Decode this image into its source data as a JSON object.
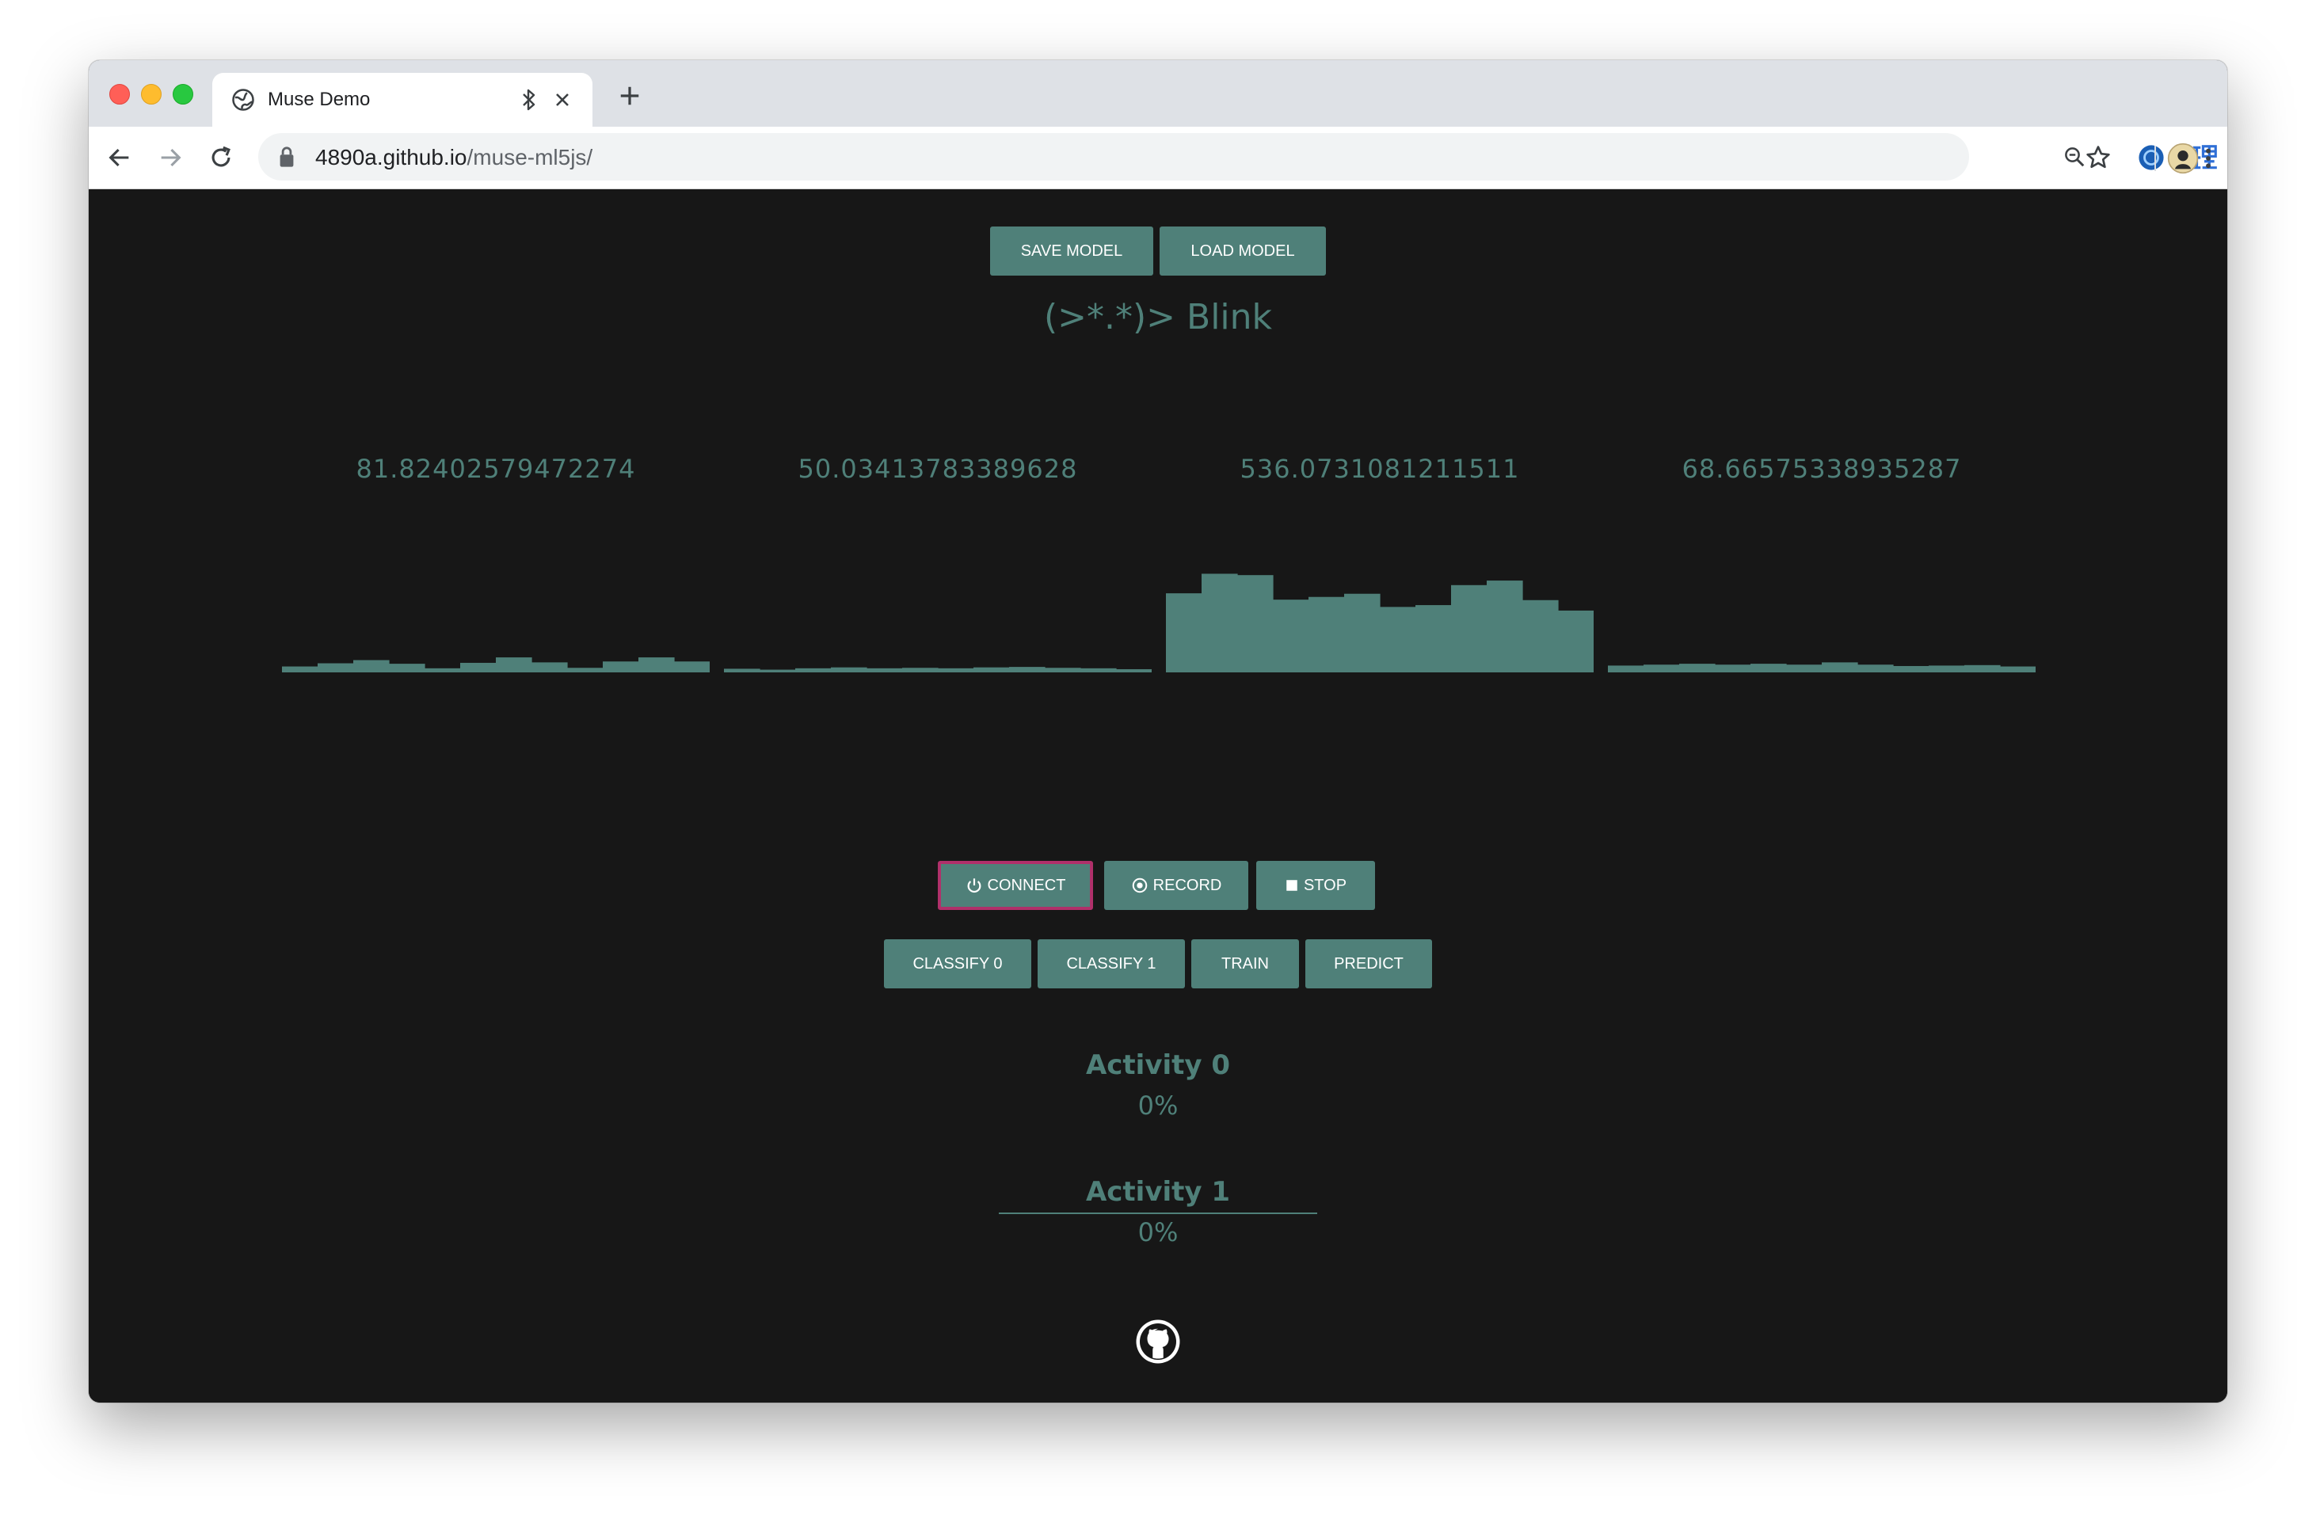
{
  "browser": {
    "tab_title": "Muse Demo",
    "url_host": "4890a.github.io",
    "url_path": "/muse-ml5js/",
    "icons": [
      "globe-icon",
      "bluetooth-icon",
      "close-icon",
      "plus-icon",
      "back-icon",
      "forward-icon",
      "reload-icon",
      "lock-icon",
      "zoom-icon",
      "star-icon",
      "extension-icon",
      "translate-icon",
      "avatar",
      "more-icon"
    ]
  },
  "page": {
    "model_buttons": {
      "save": "SAVE MODEL",
      "load": "LOAD MODEL"
    },
    "blink_text": "(>*.*)> Blink",
    "channels": [
      {
        "value": "81.82402579472274",
        "bars": [
          0.13,
          0.2,
          0.27,
          0.19,
          0.09,
          0.21,
          0.33,
          0.22,
          0.1,
          0.24,
          0.33,
          0.24
        ]
      },
      {
        "value": "50.03413783389628",
        "bars": [
          0.08,
          0.06,
          0.09,
          0.11,
          0.09,
          0.1,
          0.09,
          0.11,
          0.12,
          0.1,
          0.09,
          0.07
        ]
      },
      {
        "value": "536.0731081211511",
        "bars": [
          1.74,
          2.17,
          2.14,
          1.6,
          1.66,
          1.73,
          1.44,
          1.48,
          1.92,
          2.02,
          1.59,
          1.36
        ]
      },
      {
        "value": "68.66575338935287",
        "bars": [
          0.15,
          0.17,
          0.19,
          0.17,
          0.19,
          0.17,
          0.22,
          0.17,
          0.14,
          0.15,
          0.16,
          0.13
        ]
      }
    ],
    "chart_scale_max": 2.3,
    "controls": {
      "connect": "CONNECT",
      "record": "RECORD",
      "stop": "STOP",
      "classify0": "CLASSIFY 0",
      "classify1": "CLASSIFY 1",
      "train": "TRAIN",
      "predict": "PREDICT"
    },
    "activities": [
      {
        "title": "Activity 0",
        "percent": "0%"
      },
      {
        "title": "Activity 1",
        "percent": "0%"
      }
    ],
    "colors": {
      "accent": "#4f8079",
      "background": "#171717",
      "focus_ring": "#b0306a"
    }
  }
}
